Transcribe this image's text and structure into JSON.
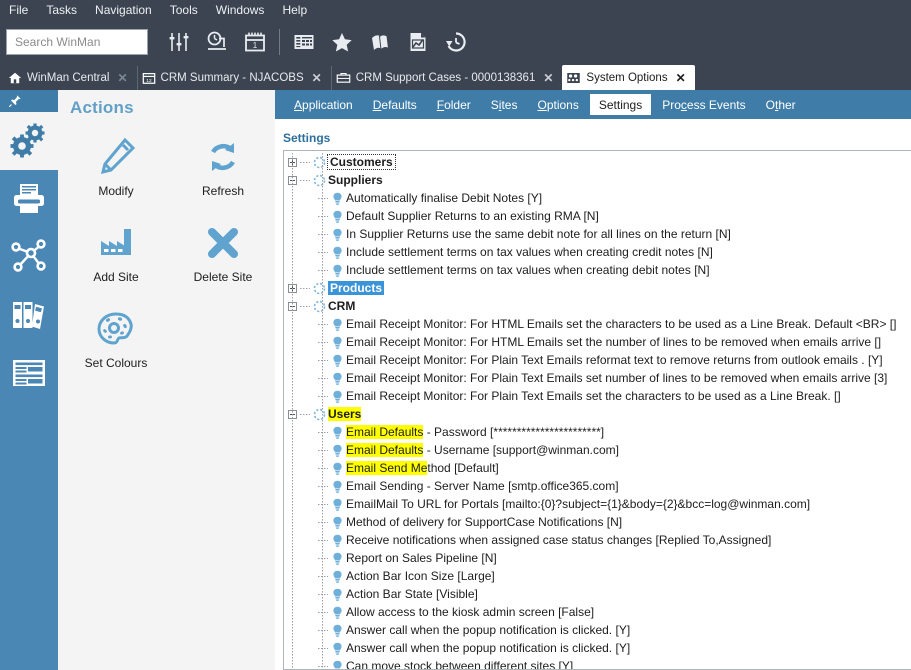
{
  "menubar": {
    "items": [
      "File",
      "Tasks",
      "Navigation",
      "Tools",
      "Windows",
      "Help"
    ]
  },
  "search": {
    "placeholder": "Search WinMan",
    "value": ""
  },
  "toolbar": {
    "buttons": [
      {
        "name": "sliders-icon",
        "title": "Filters"
      },
      {
        "name": "timer-stand-icon",
        "title": "Time Recording"
      },
      {
        "name": "calendar-icon",
        "title": "Calendar"
      },
      {
        "name": "grid-table-icon",
        "title": "Grid"
      },
      {
        "name": "star-icon",
        "title": "Favourites"
      },
      {
        "name": "flags-icon",
        "title": "Flags"
      },
      {
        "name": "chart-document-icon",
        "title": "Report"
      },
      {
        "name": "history-clock-icon",
        "title": "History"
      }
    ]
  },
  "window_tabs": [
    {
      "label": "WinMan Central",
      "icon": "home-icon",
      "active": false
    },
    {
      "label": "CRM Summary - NJACOBS",
      "icon": "calendar-icon",
      "active": false
    },
    {
      "label": "CRM Support Cases - 0000138361",
      "icon": "briefcase-icon",
      "active": false
    },
    {
      "label": "System Options",
      "icon": "system-options-icon",
      "active": true
    }
  ],
  "subtabs": [
    {
      "label": "Application",
      "accel": "A",
      "active": false
    },
    {
      "label": "Defaults",
      "accel": "D",
      "active": false
    },
    {
      "label": "Folder",
      "accel": "F",
      "active": false
    },
    {
      "label": "Sites",
      "accel": "i",
      "active": false
    },
    {
      "label": "Options",
      "accel": "O",
      "active": false
    },
    {
      "label": "Settings",
      "accel": "g",
      "active": true
    },
    {
      "label": "Process Events",
      "accel": "c",
      "active": false
    },
    {
      "label": "Other",
      "accel": "t",
      "active": false
    }
  ],
  "rail": {
    "pin_icon": "pin-icon",
    "items": [
      {
        "name": "gears-icon",
        "selected": true
      },
      {
        "name": "printer-icon",
        "selected": false
      },
      {
        "name": "network-nodes-icon",
        "selected": false
      },
      {
        "name": "binders-icon",
        "selected": false
      },
      {
        "name": "form-list-icon",
        "selected": false
      }
    ]
  },
  "actions": {
    "title": "Actions",
    "items": [
      {
        "label": "Modify",
        "icon": "pencil-icon"
      },
      {
        "label": "Refresh",
        "icon": "refresh-icon"
      },
      {
        "label": "Add Site",
        "icon": "factory-icon"
      },
      {
        "label": "Delete Site",
        "icon": "cross-icon"
      },
      {
        "label": "Set Colours",
        "icon": "palette-icon"
      }
    ]
  },
  "settings": {
    "heading": "Settings",
    "tree": [
      {
        "level": 0,
        "type": "group",
        "label": "Customers",
        "expander": "plus",
        "state": "focused"
      },
      {
        "level": 0,
        "type": "group",
        "label": "Suppliers",
        "expander": "minus",
        "state": "none"
      },
      {
        "level": 1,
        "type": "leaf",
        "label": "Automatically finalise Debit Notes [Y]"
      },
      {
        "level": 1,
        "type": "leaf",
        "label": "Default Supplier Returns to an existing RMA [N]"
      },
      {
        "level": 1,
        "type": "leaf",
        "label": "In Supplier Returns use the same debit note for all lines on the return [N]"
      },
      {
        "level": 1,
        "type": "leaf",
        "label": "Include settlement terms on tax values when creating credit notes [N]"
      },
      {
        "level": 1,
        "type": "leaf",
        "label": "Include settlement terms on tax values when creating debit notes [N]"
      },
      {
        "level": 0,
        "type": "group",
        "label": "Products",
        "expander": "plus",
        "state": "selected"
      },
      {
        "level": 0,
        "type": "group",
        "label": "CRM",
        "expander": "minus",
        "state": "none"
      },
      {
        "level": 1,
        "type": "leaf",
        "label": "Email Receipt Monitor: For HTML Emails set the characters to be used as a Line Break. Default <BR> []"
      },
      {
        "level": 1,
        "type": "leaf",
        "label": "Email Receipt Monitor: For HTML Emails set the number of lines to be removed when emails arrive []"
      },
      {
        "level": 1,
        "type": "leaf",
        "label": "Email Receipt Monitor: For Plain Text Emails reformat text to remove returns from outlook emails . [Y]"
      },
      {
        "level": 1,
        "type": "leaf",
        "label": "Email Receipt Monitor: For Plain Text Emails set number of lines to be removed when emails arrive [3]"
      },
      {
        "level": 1,
        "type": "leaf",
        "label": "Email Receipt Monitor: For Plain Text Emails set the characters to be used as a Line Break. []"
      },
      {
        "level": 0,
        "type": "group",
        "label": "Users",
        "expander": "minus",
        "state": "none",
        "highlight": "Users"
      },
      {
        "level": 1,
        "type": "leaf",
        "label": "Email Defaults - Password [***********************]",
        "highlight": "Email Defaults"
      },
      {
        "level": 1,
        "type": "leaf",
        "label": "Email Defaults - Username [support@winman.com]",
        "highlight": "Email Defaults"
      },
      {
        "level": 1,
        "type": "leaf",
        "label": "Email Send Method [Default]",
        "highlight": "Email Send Me"
      },
      {
        "level": 1,
        "type": "leaf",
        "label": "Email Sending - Server Name [smtp.office365.com]"
      },
      {
        "level": 1,
        "type": "leaf",
        "label": "EmailMail To URL for Portals [mailto:{0}?subject={1}&body={2}&bcc=log@winman.com]"
      },
      {
        "level": 1,
        "type": "leaf",
        "label": "Method of delivery for SupportCase Notifications [N]"
      },
      {
        "level": 1,
        "type": "leaf",
        "label": "Receive notifications when assigned case status changes [Replied To,Assigned]"
      },
      {
        "level": 1,
        "type": "leaf",
        "label": "Report on Sales Pipeline [N]"
      },
      {
        "level": 1,
        "type": "leaf",
        "label": "Action Bar Icon Size [Large]"
      },
      {
        "level": 1,
        "type": "leaf",
        "label": "Action Bar State [Visible]"
      },
      {
        "level": 1,
        "type": "leaf",
        "label": "Allow access to the kiosk admin screen [False]"
      },
      {
        "level": 1,
        "type": "leaf",
        "label": "Answer call when the popup notification is clicked. [Y]"
      },
      {
        "level": 1,
        "type": "leaf",
        "label": "Answer call when the popup notification is clicked. [Y]"
      },
      {
        "level": 1,
        "type": "leaf",
        "label": "Can move stock between different sites [Y]"
      }
    ]
  },
  "colors": {
    "chrome": "#3b4450",
    "ribbon": "#3f7da8",
    "rail": "#4a87b5",
    "accent": "#62a0c8",
    "highlight": "#ffff00",
    "selection": "#3a94d8",
    "panel": "#f4f4f4"
  }
}
